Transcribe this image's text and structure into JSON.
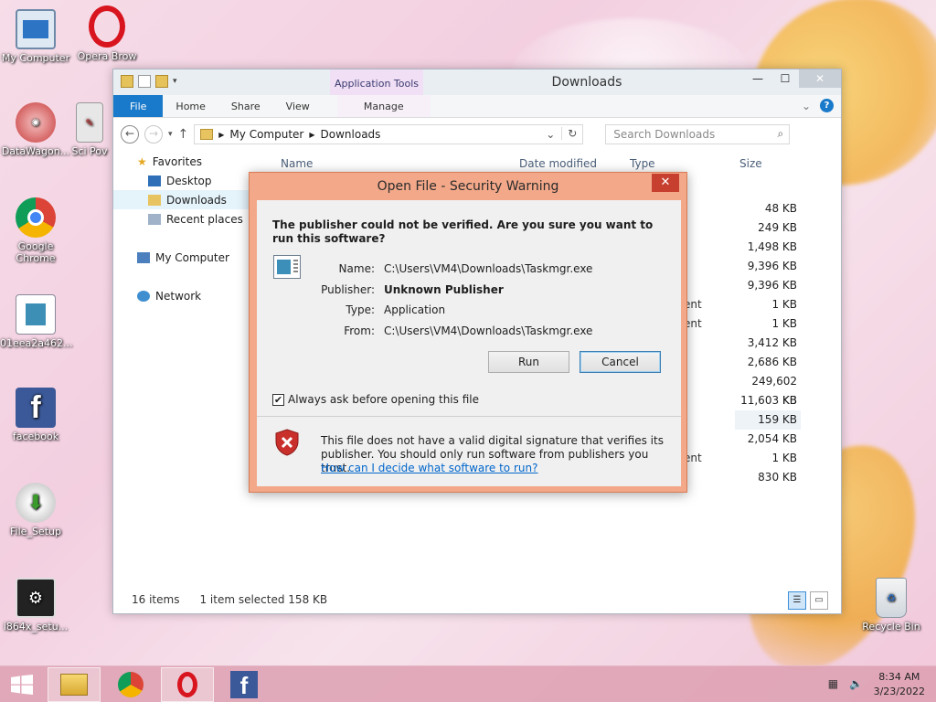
{
  "desktop": {
    "icons": [
      {
        "label": "My Computer",
        "icon": "computer-icon"
      },
      {
        "label": "Opera Brow",
        "icon": "opera-icon"
      },
      {
        "label": "DataWagon...",
        "icon": "datawagon-icon"
      },
      {
        "label": "Sci Pov",
        "icon": "app-icon"
      },
      {
        "label": "Google Chrome",
        "icon": "chrome-icon"
      },
      {
        "label": "01eea2a462...",
        "icon": "image-file-icon"
      },
      {
        "label": "facebook",
        "icon": "facebook-icon"
      },
      {
        "label": "File_Setup",
        "icon": "setup-icon"
      },
      {
        "label": "i864x_setu...",
        "icon": "installer-icon"
      },
      {
        "label": "Recycle Bin",
        "icon": "recycle-bin-icon"
      }
    ]
  },
  "explorer": {
    "title": "Downloads",
    "app_tools": "Application Tools",
    "tabs": [
      "File",
      "Home",
      "Share",
      "View",
      "Manage"
    ],
    "breadcrumb": [
      "My Computer",
      "Downloads"
    ],
    "search_placeholder": "Search Downloads",
    "nav": {
      "favorites": "Favorites",
      "desktop": "Desktop",
      "downloads": "Downloads",
      "recent": "Recent places",
      "my_computer": "My Computer",
      "network": "Network"
    },
    "columns": {
      "name": "Name",
      "date": "Date modified",
      "type": "Type",
      "size": "Size"
    },
    "type_fragments": [
      "ent",
      "ent",
      "ent"
    ],
    "sizes": [
      "48 KB",
      "249 KB",
      "1,498 KB",
      "9,396 KB",
      "9,396 KB",
      "1 KB",
      "1 KB",
      "3,412 KB",
      "2,686 KB",
      "249,602 KB",
      "11,603 KB",
      "159 KB",
      "2,054 KB",
      "1 KB",
      "830 KB"
    ],
    "status": {
      "items": "16 items",
      "selected": "1 item selected  158 KB"
    }
  },
  "dialog": {
    "title": "Open File - Security Warning",
    "question": "The publisher could not be verified.  Are you sure you want to run this software?",
    "fields": {
      "name_label": "Name:",
      "name_value": "C:\\Users\\VM4\\Downloads\\Taskmgr.exe",
      "publisher_label": "Publisher:",
      "publisher_value": "Unknown Publisher",
      "type_label": "Type:",
      "type_value": "Application",
      "from_label": "From:",
      "from_value": "C:\\Users\\VM4\\Downloads\\Taskmgr.exe"
    },
    "run_label": "Run",
    "cancel_label": "Cancel",
    "checkbox_label": "Always ask before opening this file",
    "checkbox_checked": true,
    "warning": "This file does not have a valid digital signature that verifies its publisher.  You should only run software from publishers you trust.",
    "link": "How can I decide what software to run?"
  },
  "taskbar": {
    "time": "8:34 AM",
    "date": "3/23/2022"
  }
}
